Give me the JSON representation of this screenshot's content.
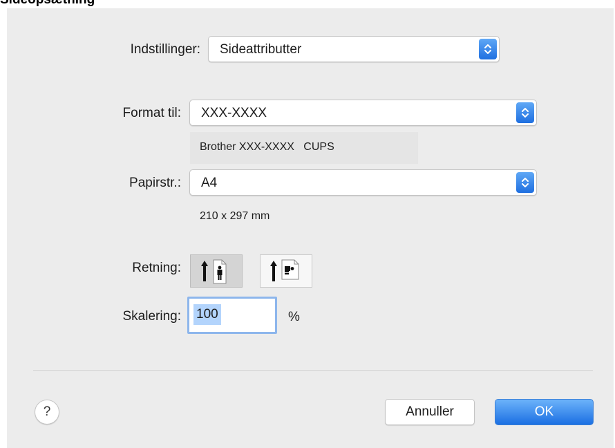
{
  "page": {
    "heading": "Sideopsætning"
  },
  "dialog": {
    "settings": {
      "label": "Indstillinger:",
      "value": "Sideattributter"
    },
    "format_for": {
      "label": "Format til:",
      "value": "XXX-XXXX",
      "printer_info": "Brother XXX-XXXX   CUPS"
    },
    "paper_size": {
      "label": "Papirstr.:",
      "value": "A4",
      "dimensions": "210 x 297 mm"
    },
    "orientation": {
      "label": "Retning:",
      "options": [
        {
          "name": "portrait",
          "icon": "portrait-orientation-icon",
          "selected": true
        },
        {
          "name": "landscape",
          "icon": "landscape-orientation-icon",
          "selected": false
        }
      ]
    },
    "scaling": {
      "label": "Skalering:",
      "value": "100",
      "unit": "%"
    },
    "buttons": {
      "help_label": "?",
      "cancel_label": "Annuller",
      "ok_label": "OK"
    },
    "colors": {
      "accent": "#2a7ae8",
      "panel_background": "#ececec",
      "selection_highlight": "#b3d4fc"
    }
  }
}
